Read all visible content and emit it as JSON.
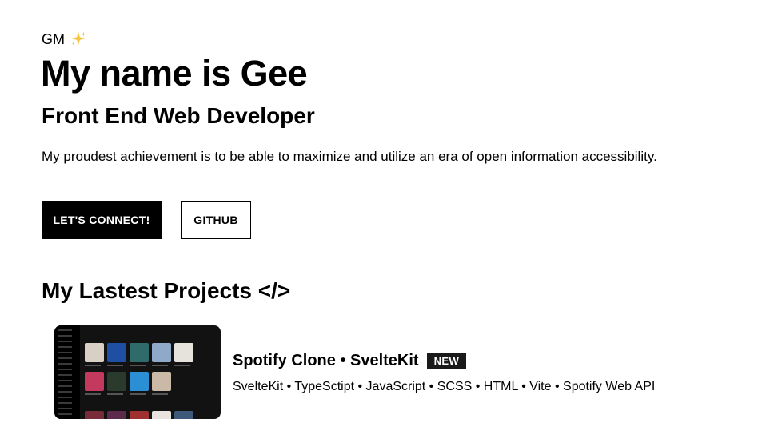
{
  "hero": {
    "greeting": "GM",
    "greeting_icon": "sparkles-icon",
    "title": "My name is Gee",
    "subtitle": "Front End Web Developer",
    "description": "My proudest achievement is to be able to maximize and utilize an era of open information accessibility."
  },
  "actions": {
    "connect_label": "LET'S CONNECT!",
    "github_label": "GITHUB"
  },
  "projects": {
    "heading": "My Lastest Projects </>",
    "items": [
      {
        "title": "Spotify Clone • SvelteKit",
        "badge": "NEW",
        "stack": "SvelteKit • TypeSctipt • JavaScript • SCSS • HTML • Vite • Spotify Web API"
      }
    ]
  },
  "colors": {
    "primary": "#000000",
    "background": "#ffffff",
    "accent": "#f5c542"
  }
}
